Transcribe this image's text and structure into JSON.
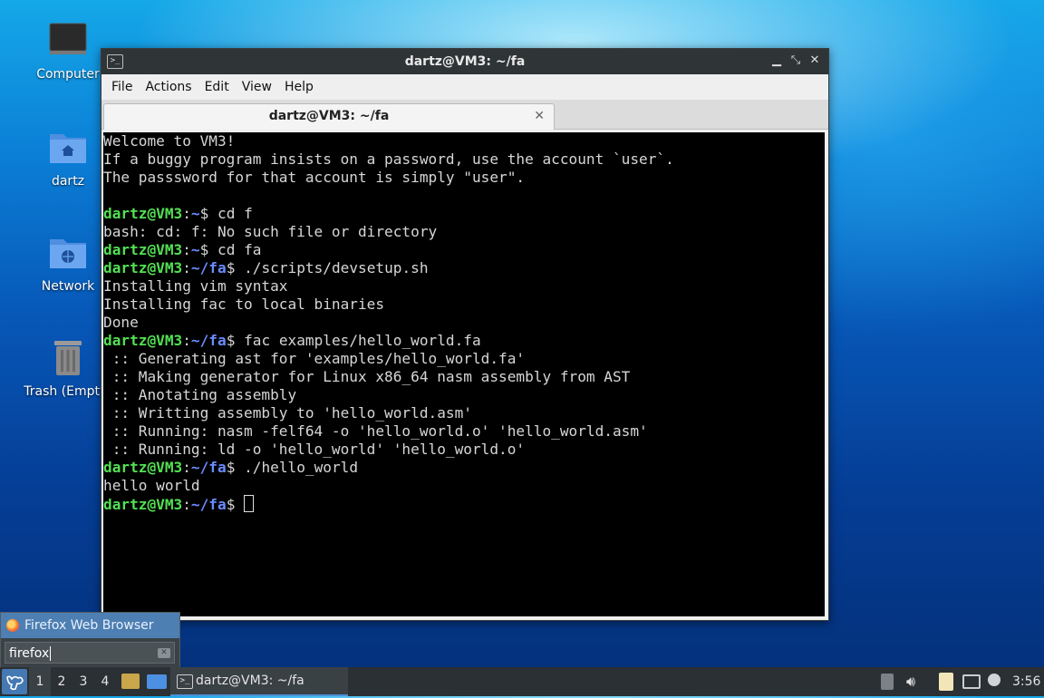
{
  "desktop": {
    "icons": [
      {
        "label": "Computer"
      },
      {
        "label": "dartz"
      },
      {
        "label": "Network"
      },
      {
        "label": "Trash (Empty)"
      }
    ]
  },
  "window": {
    "title": "dartz@VM3: ~/fa",
    "menu": [
      "File",
      "Actions",
      "Edit",
      "View",
      "Help"
    ],
    "tab_title": "dartz@VM3: ~/fa",
    "tab_close": "✕",
    "controls": {
      "minimize": "▁",
      "maximize": "⤡",
      "close": "✕"
    }
  },
  "terminal": {
    "user": "dartz@VM3",
    "lines": [
      "Welcome to VM3!",
      "If a buggy program insists on a password, use the account `user`.",
      "The passsword for that account is simply \"user\".",
      "",
      "",
      "bash: cd: f: No such file or directory",
      "",
      "",
      "Installing vim syntax",
      "Installing fac to local binaries",
      "Done",
      "",
      " :: Generating ast for 'examples/hello_world.fa'",
      " :: Making generator for Linux x86_64 nasm assembly from AST",
      " :: Anotating assembly",
      " :: Writting assembly to 'hello_world.asm'",
      " :: Running: nasm -felf64 -o 'hello_world.o' 'hello_world.asm'",
      " :: Running: ld -o 'hello_world' 'hello_world.o'",
      "",
      "hello world",
      ""
    ],
    "prompts": {
      "p4": {
        "path": "~",
        "cmd": " cd f"
      },
      "p6": {
        "path": "~",
        "cmd": " cd fa"
      },
      "p7": {
        "path": "~/fa",
        "cmd": " ./scripts/devsetup.sh"
      },
      "p11": {
        "path": "~/fa",
        "cmd": " fac examples/hello_world.fa"
      },
      "p18": {
        "path": "~/fa",
        "cmd": " ./hello_world"
      },
      "p20": {
        "path": "~/fa",
        "cmd": " "
      }
    }
  },
  "search_popup": {
    "result": "Firefox Web Browser",
    "query": "firefox"
  },
  "taskbar": {
    "workspaces": [
      "1",
      "2",
      "3",
      "4"
    ],
    "task_title": "dartz@VM3: ~/fa",
    "clock": "3:56"
  },
  "colors": {
    "prompt_user": "#53e053",
    "prompt_path": "#6a8cff",
    "selection": "#4d7fb3"
  }
}
